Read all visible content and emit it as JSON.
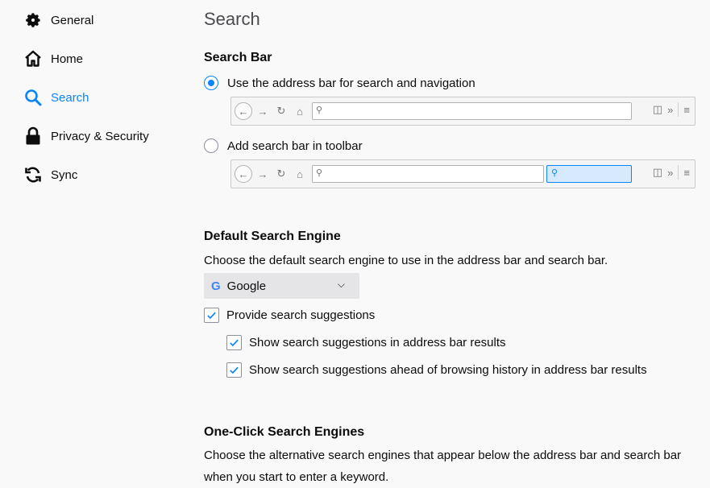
{
  "sidebar": {
    "items": [
      {
        "label": "General",
        "icon": "gear-icon",
        "selected": false
      },
      {
        "label": "Home",
        "icon": "home-icon",
        "selected": false
      },
      {
        "label": "Search",
        "icon": "search-icon",
        "selected": true
      },
      {
        "label": "Privacy & Security",
        "icon": "lock-icon",
        "selected": false
      },
      {
        "label": "Sync",
        "icon": "sync-icon",
        "selected": false
      }
    ]
  },
  "main": {
    "title": "Search",
    "search_bar": {
      "heading": "Search Bar",
      "option_address": "Use the address bar for search and navigation",
      "option_address_selected": true,
      "option_toolbar": "Add search bar in toolbar",
      "option_toolbar_selected": false
    },
    "default_engine": {
      "heading": "Default Search Engine",
      "description": "Choose the default search engine to use in the address bar and search bar.",
      "selected_engine": "Google",
      "engine_icon_glyph": "G",
      "provide_suggestions": "Provide search suggestions",
      "provide_suggestions_checked": true,
      "show_in_address_bar": "Show search suggestions in address bar results",
      "show_in_address_bar_checked": true,
      "show_ahead_of_history": "Show search suggestions ahead of browsing history in address bar results",
      "show_ahead_of_history_checked": true
    },
    "one_click": {
      "heading": "One-Click Search Engines",
      "description_line1": "Choose the alternative search engines that appear below the address bar and search bar",
      "description_line2": "when you start to enter a keyword."
    }
  },
  "colors": {
    "accent": "#0a84ff",
    "background": "#f9f9fa",
    "text": "#0c0c0d"
  }
}
